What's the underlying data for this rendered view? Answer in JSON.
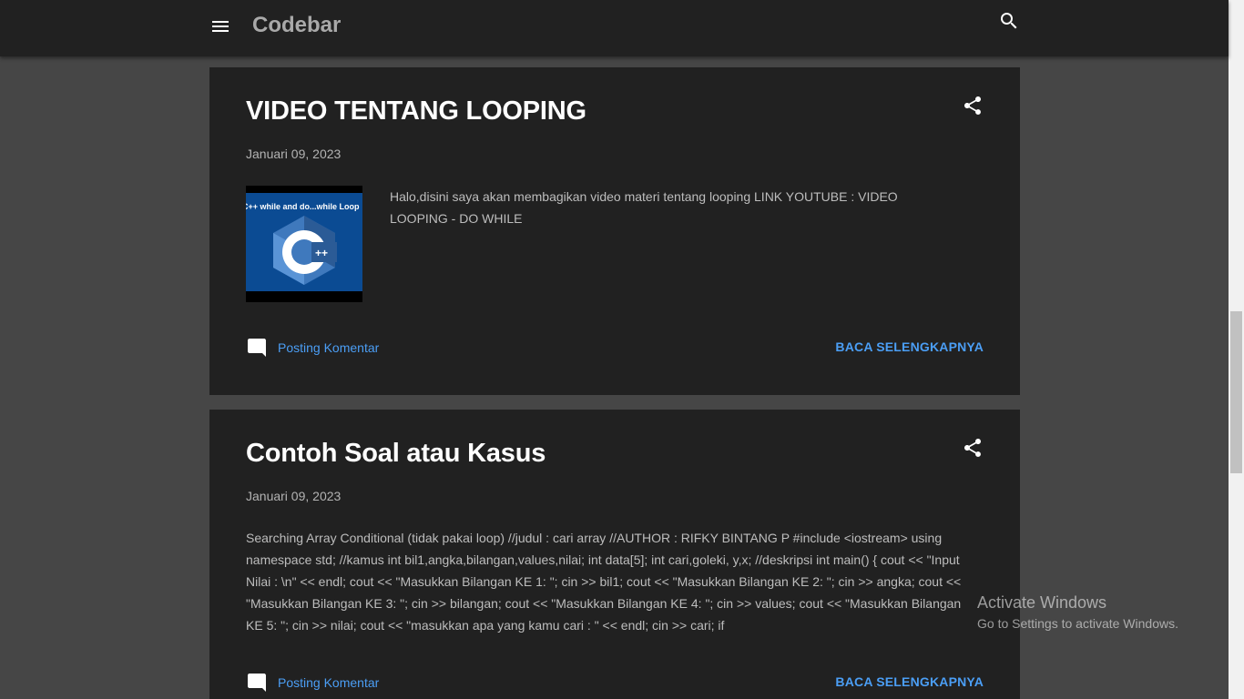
{
  "header": {
    "brand": "Codebar",
    "menu_icon": "hamburger-menu-icon",
    "search_icon": "search-icon"
  },
  "posts": [
    {
      "title": "VIDEO TENTANG LOOPING",
      "date": "Januari 09, 2023",
      "thumbnail_caption": "C++ while and do...while Loop",
      "thumbnail_logo": "++",
      "snippet": " Halo,disini saya akan membagikan video materi tentang looping LINK YOUTUBE :  VIDEO LOOPING - DO WHILE",
      "comment_label": "Posting Komentar",
      "read_more_label": "BACA SELENGKAPNYA"
    },
    {
      "title": "Contoh Soal atau Kasus",
      "date": "Januari 09, 2023",
      "snippet": " Searching Array Conditional (tidak pakai loop) //judul : cari array //AUTHOR : RIFKY BINTANG P #include <iostream> using namespace std; //kamus int bil1,angka,bilangan,values,nilai; int data[5]; int cari,goleki, y,x; //deskripsi int main() { cout << \"Input Nilai : \\n\" << endl;     cout << \"Masukkan Bilangan KE 1: \"; cin >> bil1;     cout << \"Masukkan Bilangan KE 2: \"; cin >> angka;     cout << \"Masukkan Bilangan KE 3: \"; cin >> bilangan;     cout << \"Masukkan Bilangan KE 4: \"; cin >> values;     cout << \"Masukkan Bilangan KE 5: \"; cin >> nilai;     cout << \"masukkan apa yang kamu cari : \" << endl; cin >> cari;     if",
      "comment_label": "Posting Komentar",
      "read_more_label": "BACA SELENGKAPNYA"
    }
  ],
  "watermark": {
    "title": "Activate Windows",
    "subtitle": "Go to Settings to activate Windows."
  },
  "colors": {
    "page_bg": "#464646",
    "card_bg": "#212121",
    "link": "#4b9ef5",
    "title": "#ffffff"
  }
}
